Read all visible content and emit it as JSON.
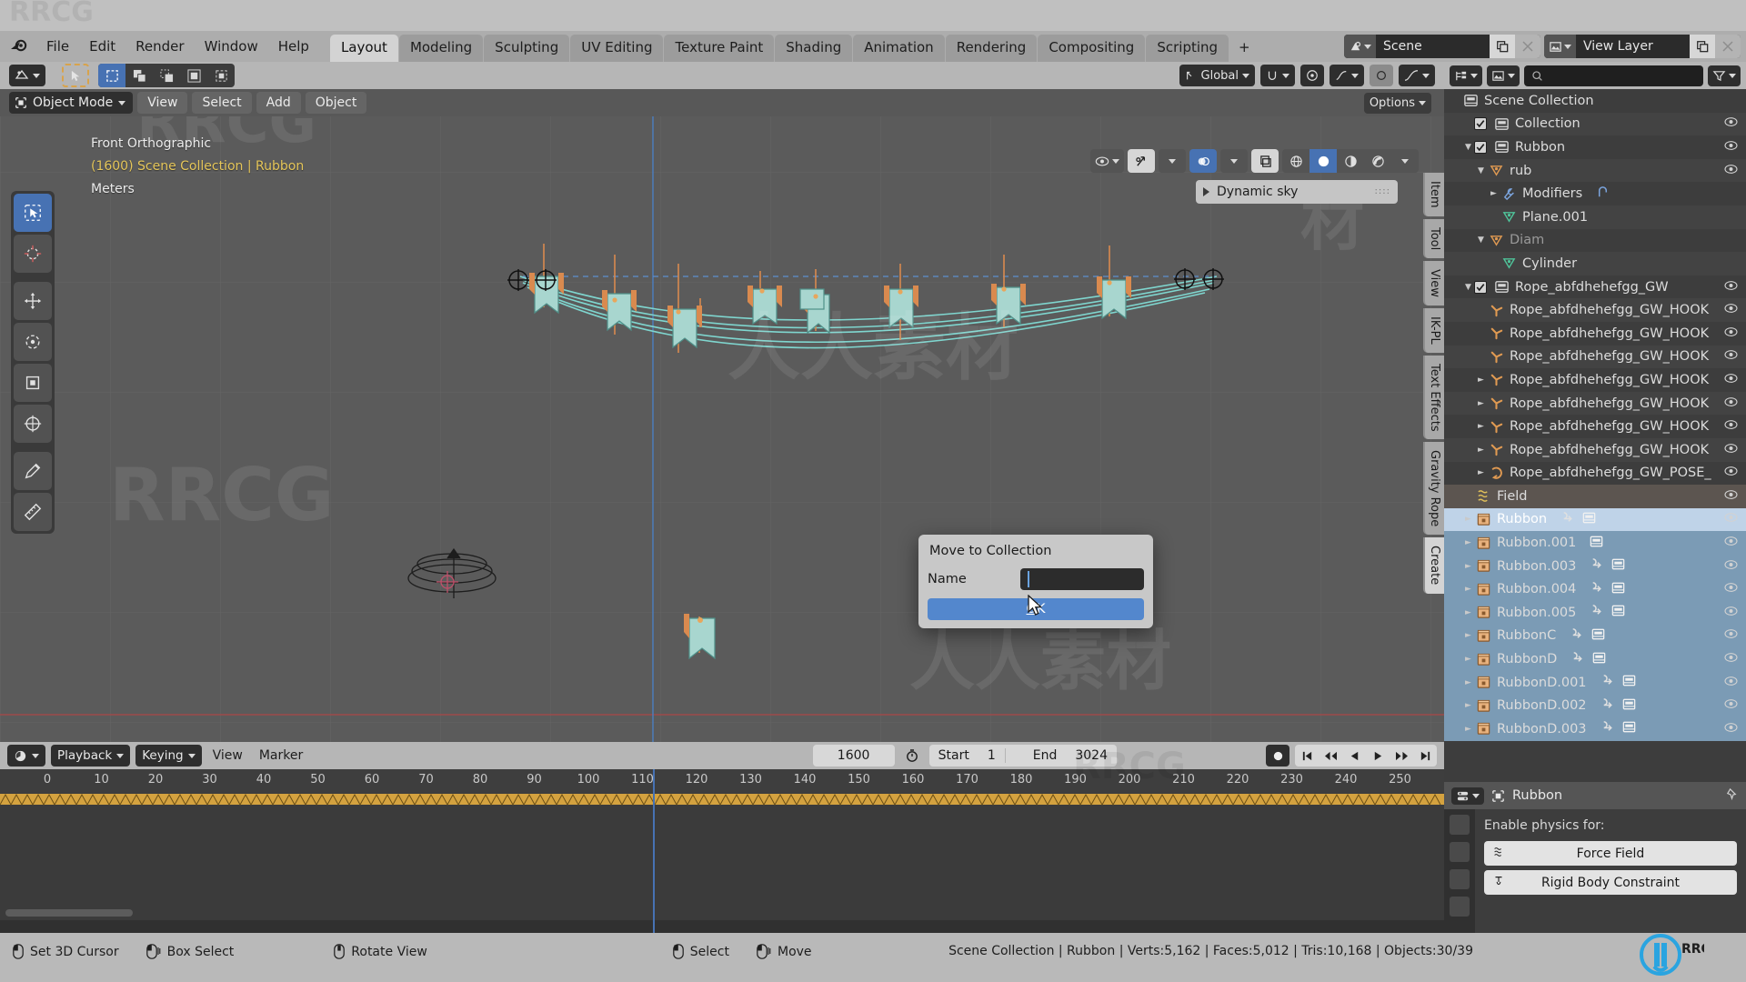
{
  "app": {
    "name": "Blender"
  },
  "menubar": {
    "items": [
      "File",
      "Edit",
      "Render",
      "Window",
      "Help"
    ],
    "workspace_tabs": [
      {
        "label": "Layout",
        "active": true
      },
      {
        "label": "Modeling",
        "active": false
      },
      {
        "label": "Sculpting",
        "active": false
      },
      {
        "label": "UV Editing",
        "active": false
      },
      {
        "label": "Texture Paint",
        "active": false
      },
      {
        "label": "Shading",
        "active": false
      },
      {
        "label": "Animation",
        "active": false
      },
      {
        "label": "Rendering",
        "active": false
      },
      {
        "label": "Compositing",
        "active": false
      },
      {
        "label": "Scripting",
        "active": false
      },
      {
        "label": "+",
        "active": false
      }
    ],
    "scene_label": "Scene",
    "viewlayer_label": "View Layer"
  },
  "viewport": {
    "header": {
      "transform_orientation": "Global",
      "options_label": "Options"
    },
    "subheader": {
      "mode": "Object Mode",
      "menus": [
        "View",
        "Select",
        "Add",
        "Object"
      ]
    },
    "overlay_text": {
      "view_name": "Front Orthographic",
      "scene_info": "(1600) Scene Collection | Rubbon",
      "units": "Meters"
    },
    "sidebar_tabs": [
      {
        "label": "Item",
        "sel": false
      },
      {
        "label": "Tool",
        "sel": false
      },
      {
        "label": "View",
        "sel": false
      },
      {
        "label": "IK-PL",
        "sel": false
      },
      {
        "label": "Text Effects",
        "sel": false
      },
      {
        "label": "Gravity Rope",
        "sel": false
      },
      {
        "label": "Create",
        "sel": true
      }
    ],
    "panel": {
      "dynamic_sky_label": "Dynamic sky"
    },
    "toolbar_icons": [
      "select-box-icon",
      "cursor-icon",
      "move-icon",
      "rotate-icon",
      "scale-icon",
      "transform-icon",
      "annotate-icon",
      "measure-icon"
    ]
  },
  "outliner": {
    "search_placeholder": "",
    "rows": [
      {
        "label": "Scene Collection",
        "indent": 0,
        "icon": "collection-icon",
        "disclosure": "",
        "checkbox": false,
        "eye": false,
        "sel": "none",
        "dim": false,
        "xtras": []
      },
      {
        "label": "Collection",
        "indent": 1,
        "icon": "collection-icon",
        "disclosure": "",
        "checkbox": true,
        "eye": true,
        "sel": "none",
        "dim": false,
        "xtras": []
      },
      {
        "label": "Rubbon",
        "indent": 1,
        "icon": "collection-icon",
        "disclosure": "down",
        "checkbox": true,
        "eye": true,
        "sel": "none",
        "dim": false,
        "xtras": []
      },
      {
        "label": "rub",
        "indent": 2,
        "icon": "curve-data-icon",
        "disclosure": "down",
        "checkbox": false,
        "eye": true,
        "sel": "none",
        "dim": false,
        "xtras": []
      },
      {
        "label": "Modifiers",
        "indent": 3,
        "icon": "wrench-icon",
        "disclosure": "right",
        "checkbox": false,
        "eye": false,
        "sel": "none",
        "dim": false,
        "xtras": [
          "hook-modifier-icon"
        ]
      },
      {
        "label": "Plane.001",
        "indent": 3,
        "icon": "mesh-data-icon",
        "disclosure": "",
        "checkbox": false,
        "eye": false,
        "sel": "none",
        "dim": false,
        "xtras": []
      },
      {
        "label": "Diam",
        "indent": 2,
        "icon": "curve-data-icon",
        "disclosure": "down",
        "checkbox": false,
        "eye": false,
        "sel": "none",
        "dim": true,
        "xtras": []
      },
      {
        "label": "Cylinder",
        "indent": 3,
        "icon": "mesh-data-icon",
        "disclosure": "",
        "checkbox": false,
        "eye": false,
        "sel": "none",
        "dim": false,
        "xtras": []
      },
      {
        "label": "Rope_abfdhehefgg_GW",
        "indent": 1,
        "icon": "collection-icon",
        "disclosure": "down",
        "checkbox": true,
        "eye": true,
        "sel": "none",
        "dim": false,
        "xtras": []
      },
      {
        "label": "Rope_abfdhehefgg_GW_HOOK",
        "indent": 2,
        "icon": "empty-axes-icon",
        "disclosure": "",
        "checkbox": false,
        "eye": true,
        "sel": "none",
        "dim": false,
        "xtras": []
      },
      {
        "label": "Rope_abfdhehefgg_GW_HOOK",
        "indent": 2,
        "icon": "empty-axes-icon",
        "disclosure": "",
        "checkbox": false,
        "eye": true,
        "sel": "none",
        "dim": false,
        "xtras": []
      },
      {
        "label": "Rope_abfdhehefgg_GW_HOOK",
        "indent": 2,
        "icon": "empty-axes-icon",
        "disclosure": "",
        "checkbox": false,
        "eye": true,
        "sel": "none",
        "dim": false,
        "xtras": []
      },
      {
        "label": "Rope_abfdhehefgg_GW_HOOK",
        "indent": 2,
        "icon": "empty-axes-icon",
        "disclosure": "right",
        "checkbox": false,
        "eye": true,
        "sel": "none",
        "dim": false,
        "xtras": []
      },
      {
        "label": "Rope_abfdhehefgg_GW_HOOK",
        "indent": 2,
        "icon": "empty-axes-icon",
        "disclosure": "right",
        "checkbox": false,
        "eye": true,
        "sel": "none",
        "dim": false,
        "xtras": []
      },
      {
        "label": "Rope_abfdhehefgg_GW_HOOK",
        "indent": 2,
        "icon": "empty-axes-icon",
        "disclosure": "right",
        "checkbox": false,
        "eye": true,
        "sel": "none",
        "dim": false,
        "xtras": []
      },
      {
        "label": "Rope_abfdhehefgg_GW_HOOK",
        "indent": 2,
        "icon": "empty-axes-icon",
        "disclosure": "right",
        "checkbox": false,
        "eye": true,
        "sel": "none",
        "dim": false,
        "xtras": []
      },
      {
        "label": "Rope_abfdhehefgg_GW_POSE_",
        "indent": 2,
        "icon": "empty-arrow-icon",
        "disclosure": "right",
        "checkbox": false,
        "eye": true,
        "sel": "none",
        "dim": false,
        "xtras": []
      },
      {
        "label": "Field",
        "indent": 1,
        "icon": "force-field-icon",
        "disclosure": "",
        "checkbox": false,
        "eye": true,
        "sel": "field",
        "dim": false,
        "xtras": []
      },
      {
        "label": "Rubbon",
        "indent": 1,
        "icon": "object-data-icon",
        "disclosure": "right",
        "checkbox": false,
        "eye": true,
        "sel": "active",
        "dim": false,
        "xtras": [
          "modifier-arrow-icon",
          "mesh-box-icon"
        ]
      },
      {
        "label": "Rubbon.001",
        "indent": 1,
        "icon": "object-data-icon",
        "disclosure": "right",
        "checkbox": false,
        "eye": true,
        "sel": "sel",
        "dim": false,
        "xtras": [
          "mesh-box-icon"
        ]
      },
      {
        "label": "Rubbon.003",
        "indent": 1,
        "icon": "object-data-icon",
        "disclosure": "right",
        "checkbox": false,
        "eye": true,
        "sel": "sel",
        "dim": false,
        "xtras": [
          "modifier-arrow-icon",
          "mesh-box-icon"
        ]
      },
      {
        "label": "Rubbon.004",
        "indent": 1,
        "icon": "object-data-icon",
        "disclosure": "right",
        "checkbox": false,
        "eye": true,
        "sel": "sel",
        "dim": false,
        "xtras": [
          "modifier-arrow-icon",
          "mesh-box-icon"
        ]
      },
      {
        "label": "Rubbon.005",
        "indent": 1,
        "icon": "object-data-icon",
        "disclosure": "right",
        "checkbox": false,
        "eye": true,
        "sel": "sel",
        "dim": false,
        "xtras": [
          "modifier-arrow-icon",
          "mesh-box-icon"
        ]
      },
      {
        "label": "RubbonC",
        "indent": 1,
        "icon": "object-data-icon",
        "disclosure": "right",
        "checkbox": false,
        "eye": true,
        "sel": "sel",
        "dim": false,
        "xtras": [
          "modifier-arrow-icon",
          "mesh-box-icon"
        ]
      },
      {
        "label": "RubbonD",
        "indent": 1,
        "icon": "object-data-icon",
        "disclosure": "right",
        "checkbox": false,
        "eye": true,
        "sel": "sel",
        "dim": false,
        "xtras": [
          "modifier-arrow-icon",
          "mesh-box-icon"
        ]
      },
      {
        "label": "RubbonD.001",
        "indent": 1,
        "icon": "object-data-icon",
        "disclosure": "right",
        "checkbox": false,
        "eye": true,
        "sel": "sel",
        "dim": false,
        "xtras": [
          "modifier-arrow-icon",
          "mesh-box-icon"
        ]
      },
      {
        "label": "RubbonD.002",
        "indent": 1,
        "icon": "object-data-icon",
        "disclosure": "right",
        "checkbox": false,
        "eye": true,
        "sel": "sel",
        "dim": false,
        "xtras": [
          "modifier-arrow-icon",
          "mesh-box-icon"
        ]
      },
      {
        "label": "RubbonD.003",
        "indent": 1,
        "icon": "object-data-icon",
        "disclosure": "right",
        "checkbox": false,
        "eye": true,
        "sel": "sel",
        "dim": false,
        "xtras": [
          "modifier-arrow-icon",
          "mesh-box-icon"
        ]
      }
    ]
  },
  "properties": {
    "object_name": "Rubbon",
    "enable_label": "Enable physics for:",
    "buttons": [
      {
        "label": "Force Field",
        "icon": "force-field-icon"
      },
      {
        "label": "Rigid Body Constraint",
        "icon": "rigid-body-constraint-icon"
      }
    ]
  },
  "timeline": {
    "menus": [
      "Playback",
      "Keying",
      "View",
      "Marker"
    ],
    "current_frame": "1600",
    "start_label": "Start",
    "start_value": "1",
    "end_label": "End",
    "end_value": "3024",
    "ticks": [
      "0",
      "10",
      "20",
      "30",
      "40",
      "50",
      "60",
      "70",
      "80",
      "90",
      "100",
      "110",
      "120",
      "130",
      "140",
      "150",
      "160",
      "170",
      "180",
      "190",
      "200",
      "210",
      "220",
      "230",
      "240",
      "250"
    ]
  },
  "dialog": {
    "title": "Move to Collection",
    "name_label": "Name",
    "name_value": "",
    "ok_label": "OK",
    "ok_accel": "O"
  },
  "statusbar": {
    "hints": [
      {
        "label": "Set 3D Cursor",
        "icon": "mouse-left-icon"
      },
      {
        "label": "Box Select",
        "icon": "mouse-left-drag-icon"
      },
      {
        "label": "Rotate View",
        "icon": "mouse-middle-icon"
      },
      {
        "label": "Select",
        "icon": "mouse-left-icon"
      },
      {
        "label": "Move",
        "icon": "mouse-left-drag-icon"
      }
    ],
    "stats": "Scene Collection | Rubbon | Verts:5,162 | Faces:5,012 | Tris:10,168 | Objects:30/39"
  },
  "colors": {
    "accent_blue": "#4772b3",
    "active_row": "#bfd3e8",
    "selected_row": "#7b9bb5",
    "dialog_ok": "#5387cd",
    "scene_info_text": "#e5c65a",
    "header_grey": "#b6b6b6",
    "viewport_bg": "#5b5b5b"
  },
  "watermarks": {
    "text_cn": "人人素材",
    "text_en": "RRCG"
  }
}
